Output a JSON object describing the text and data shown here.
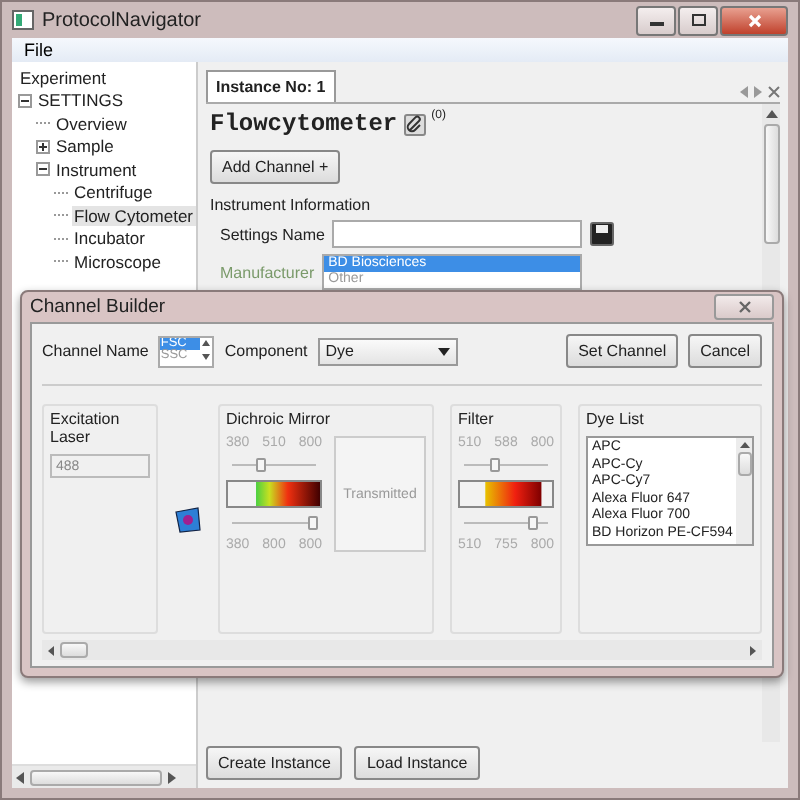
{
  "window": {
    "title": "ProtocolNavigator"
  },
  "menu": [
    "File"
  ],
  "tree": [
    {
      "label": "Experiment",
      "selected": false
    },
    {
      "label": "SETTINGS",
      "expanded": true,
      "selected": false,
      "children": [
        {
          "label": "Overview",
          "selected": false
        },
        {
          "label": "Sample",
          "expanded": false,
          "selected": false
        },
        {
          "label": "Instrument",
          "expanded": true,
          "selected": false,
          "children": [
            {
              "label": "Centrifuge",
              "selected": false
            },
            {
              "label": "Flow Cytometer",
              "selected": true
            },
            {
              "label": "Incubator",
              "selected": false
            },
            {
              "label": "Microscope",
              "selected": false
            }
          ]
        }
      ]
    }
  ],
  "tabs": [
    {
      "label": "Instance No: 1",
      "selected": true
    }
  ],
  "heading": "Flowcytometer",
  "attachment_count": "(0)",
  "add_channel_button": "Add Channel +",
  "instrument_info": {
    "title": "Instrument Information",
    "settings_name_label": "Settings Name",
    "manufacturer_label": "Manufacturer",
    "manufacturer_options": [
      {
        "label": "BD Biosciences",
        "selected": true
      },
      {
        "label": "Other",
        "selected": false
      }
    ]
  },
  "footer_buttons": [
    "Create Instance",
    "Load Instance"
  ],
  "dialog": {
    "title": "Channel Builder",
    "channel_name": {
      "label": "Channel Name",
      "options": [
        {
          "label": "FSC",
          "selected": true
        },
        {
          "label": "SSC",
          "selected": false
        }
      ]
    },
    "component": {
      "label": "Component",
      "value": "Dye"
    },
    "buttons": [
      "Set Channel",
      "Cancel"
    ],
    "laser": {
      "title": "Excitation Laser",
      "value": "488"
    },
    "dichroic": {
      "title": "Dichroic Mirror",
      "top_ticks": [
        "380",
        "510",
        "800"
      ],
      "top_slider": {
        "level": 0.33
      },
      "bottom_slider": {
        "level": 0.95
      },
      "bottom_ticks": [
        "380",
        "800",
        "800"
      ],
      "transmitted": "Transmitted"
    },
    "filter": {
      "title": "Filter",
      "top_ticks": [
        "510",
        "588",
        "800"
      ],
      "top_slider": {
        "level": 0.35
      },
      "bottom_slider": {
        "level": 0.8
      },
      "bottom_ticks": [
        "510",
        "755",
        "800"
      ]
    },
    "dye_list": {
      "title": "Dye List",
      "items": [
        "APC",
        "APC-Cy",
        "APC-Cy7",
        "Alexa Fluor 647",
        "Alexa Fluor 700",
        "BD Horizon PE-CF594"
      ]
    }
  }
}
